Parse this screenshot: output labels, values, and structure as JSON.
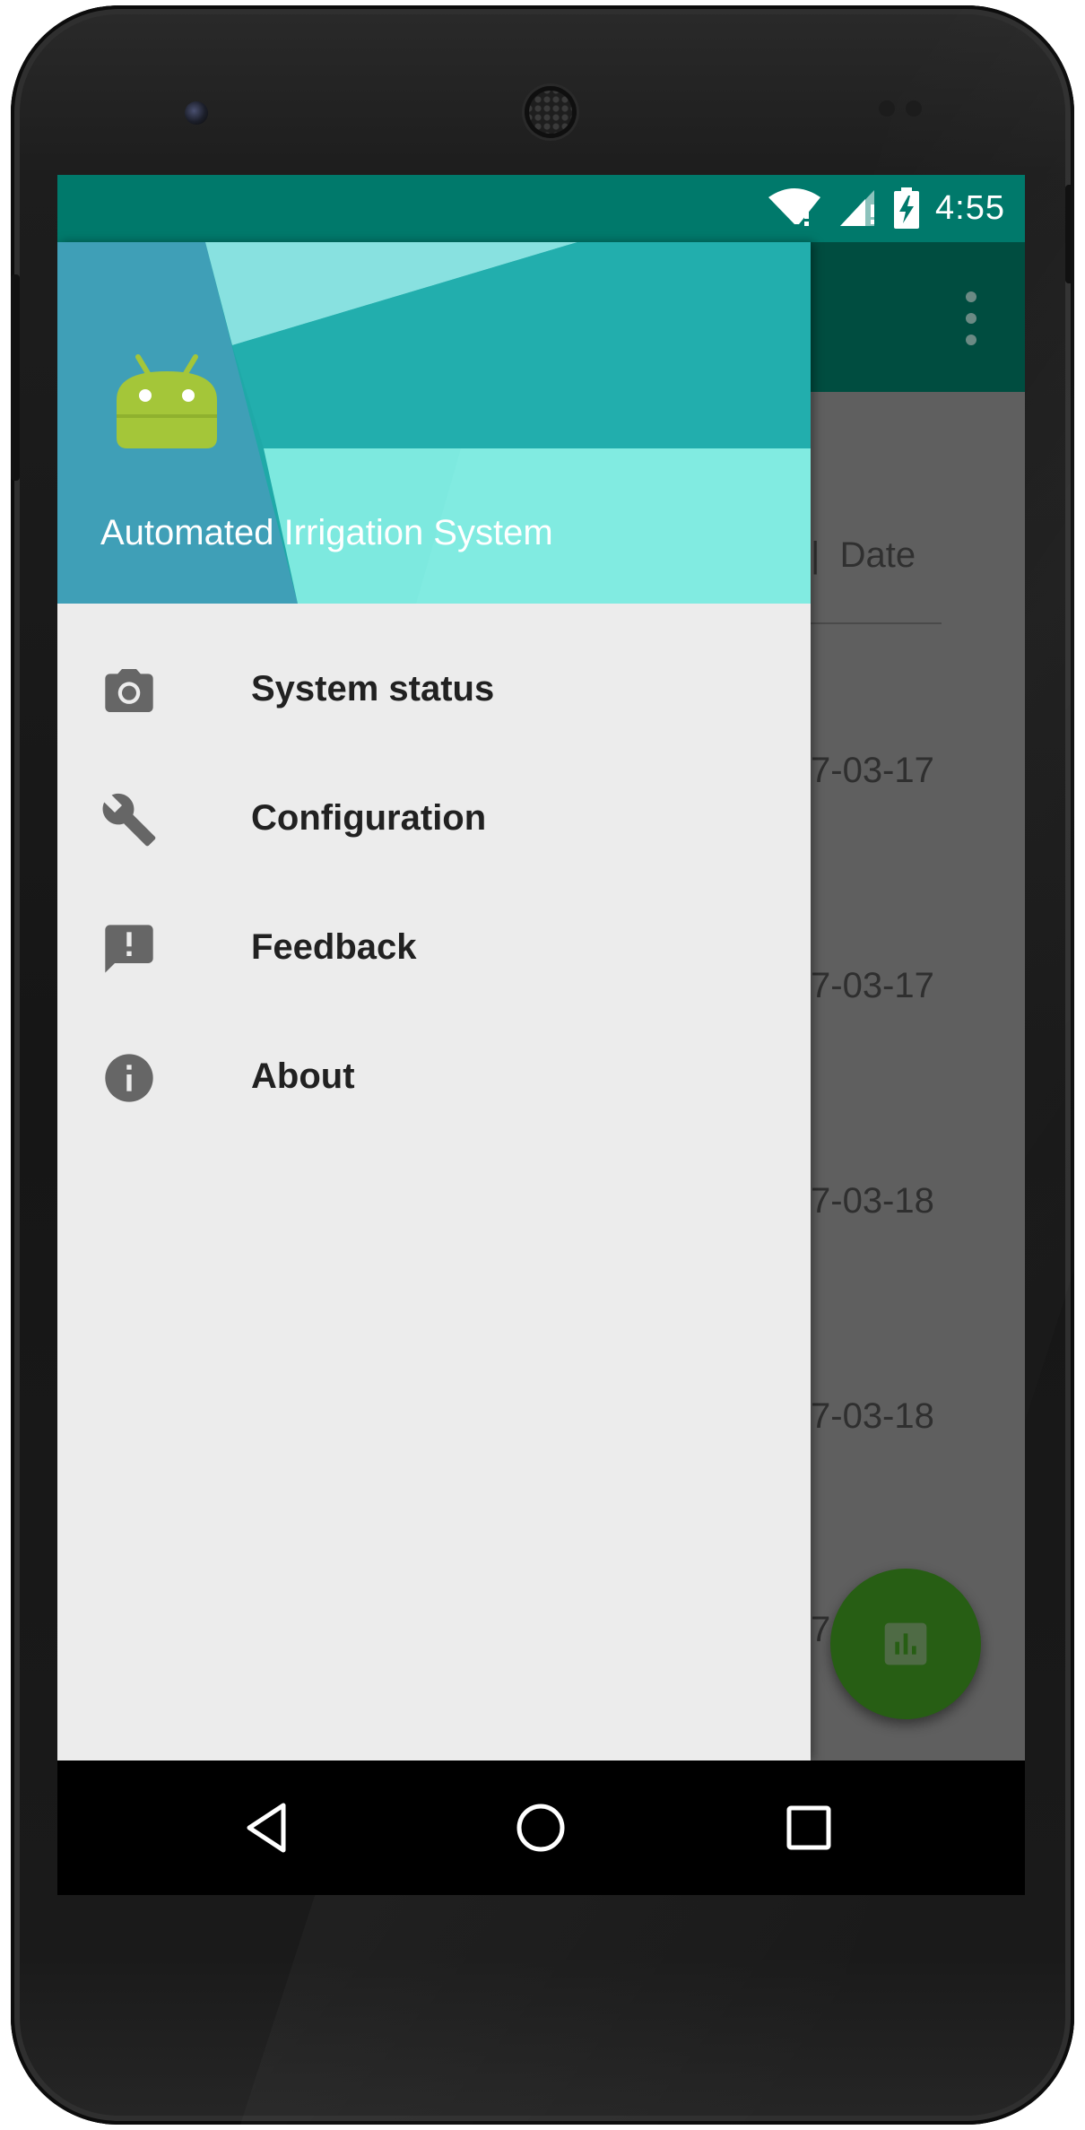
{
  "statusbar": {
    "time": "4:55"
  },
  "drawer": {
    "app_title": "Automated Irrigation System",
    "items": [
      {
        "label": "System status",
        "icon": "camera-icon"
      },
      {
        "label": "Configuration",
        "icon": "wrench-icon"
      },
      {
        "label": "Feedback",
        "icon": "feedback-icon"
      },
      {
        "label": "About",
        "icon": "info-icon"
      }
    ]
  },
  "list": {
    "header": "|  Date",
    "dates": [
      "7-03-17",
      "7-03-17",
      "7-03-18",
      "7-03-18",
      "7"
    ]
  },
  "colors": {
    "status_bar": "#00796b",
    "toolbar": "#004d40",
    "drawer_bg": "#ececec",
    "fab": "#275e14",
    "android_green": "#a4c639"
  }
}
